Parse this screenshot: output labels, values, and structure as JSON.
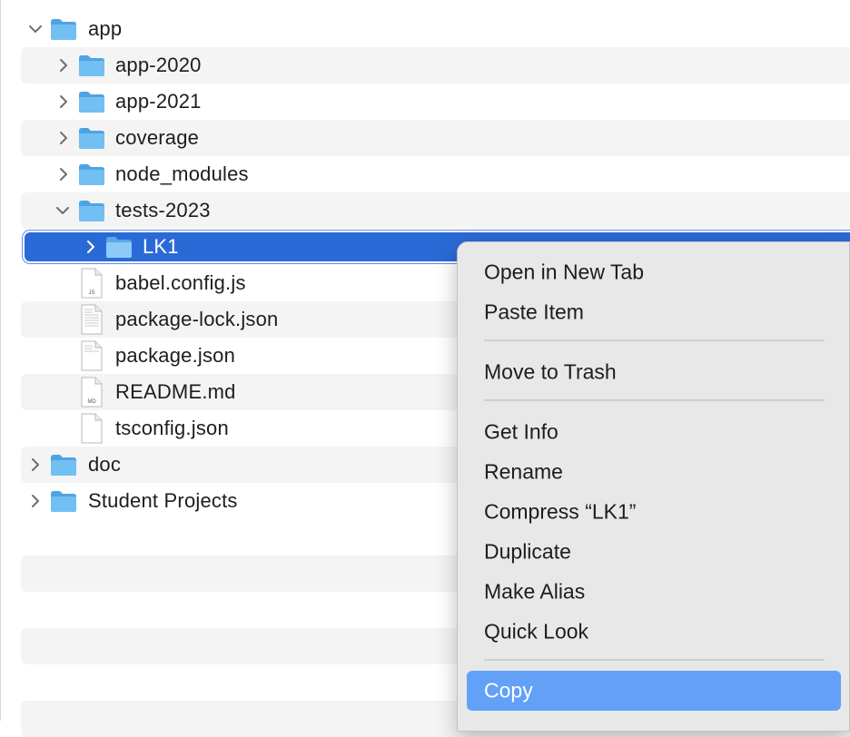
{
  "tree": {
    "items": [
      {
        "label": "app",
        "type": "folder",
        "expanded": true
      },
      {
        "label": "app-2020",
        "type": "folder",
        "expanded": false
      },
      {
        "label": "app-2021",
        "type": "folder",
        "expanded": false
      },
      {
        "label": "coverage",
        "type": "folder",
        "expanded": false
      },
      {
        "label": "node_modules",
        "type": "folder",
        "expanded": false
      },
      {
        "label": "tests-2023",
        "type": "folder",
        "expanded": true
      },
      {
        "label": "LK1",
        "type": "folder",
        "expanded": false,
        "selected": true
      },
      {
        "label": "babel.config.js",
        "type": "file",
        "badge": "JS"
      },
      {
        "label": "package-lock.json",
        "type": "file"
      },
      {
        "label": "package.json",
        "type": "file"
      },
      {
        "label": "README.md",
        "type": "file",
        "badge": "MD"
      },
      {
        "label": "tsconfig.json",
        "type": "file"
      },
      {
        "label": "doc",
        "type": "folder",
        "expanded": false
      },
      {
        "label": "Student Projects",
        "type": "folder",
        "expanded": false
      }
    ]
  },
  "context_menu": {
    "items": [
      {
        "label": "Open in New Tab"
      },
      {
        "label": "Paste Item"
      },
      {
        "label": "Move to Trash"
      },
      {
        "label": "Get Info"
      },
      {
        "label": "Rename"
      },
      {
        "label": "Compress “LK1”"
      },
      {
        "label": "Duplicate"
      },
      {
        "label": "Make Alias"
      },
      {
        "label": "Quick Look"
      },
      {
        "label": "Copy",
        "highlighted": true
      }
    ]
  },
  "colors": {
    "selection": "#2a6ad6",
    "menu_highlight": "#62a1f7",
    "folder": "#5fb4ef",
    "stripe": "#f4f4f4",
    "menu_background": "#e8e8e8"
  }
}
